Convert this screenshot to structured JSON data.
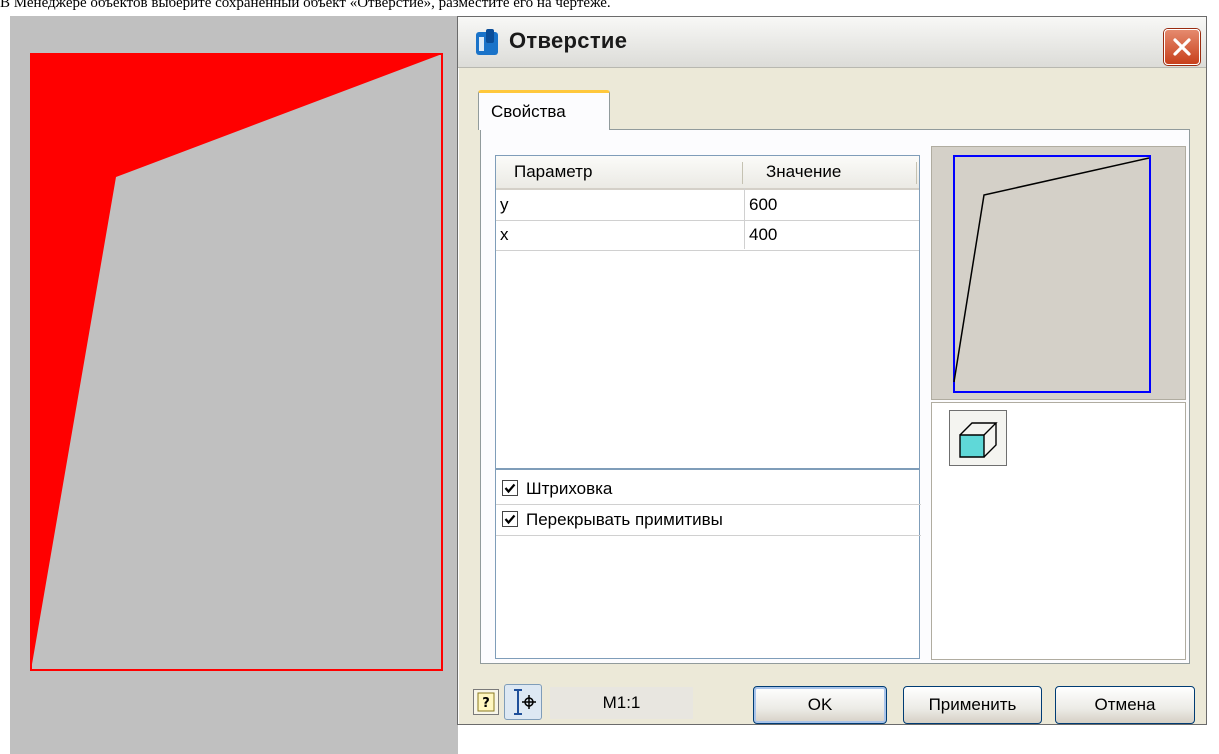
{
  "caption": "В Менеджере объектов выберите сохраненный объект «Отверстие», разместите его на чертеже.",
  "dialog": {
    "title": "Отверстие",
    "tabs": [
      {
        "label": "Свойства"
      }
    ],
    "params": {
      "headers": [
        "Параметр",
        "Значение"
      ],
      "rows": [
        {
          "name": "y",
          "value": "600"
        },
        {
          "name": "x",
          "value": "400"
        }
      ]
    },
    "options": [
      {
        "label": "Штриховка",
        "checked": true
      },
      {
        "label": "Перекрывать примитивы",
        "checked": true
      }
    ],
    "scale": "М1:1",
    "buttons": {
      "ok": "OK",
      "apply": "Применить",
      "cancel": "Отмена"
    }
  },
  "colors": {
    "canvas_bg": "#c0c0c0",
    "hatch_fill": "#ff0000",
    "preview_frame": "#0000ff",
    "cube_face": "#5fd8d8"
  },
  "icons": {
    "app": "app-logo-icon",
    "close": "close-icon",
    "help": "help-icon",
    "snap": "snap-point-icon",
    "cube": "3d-cube-icon"
  }
}
